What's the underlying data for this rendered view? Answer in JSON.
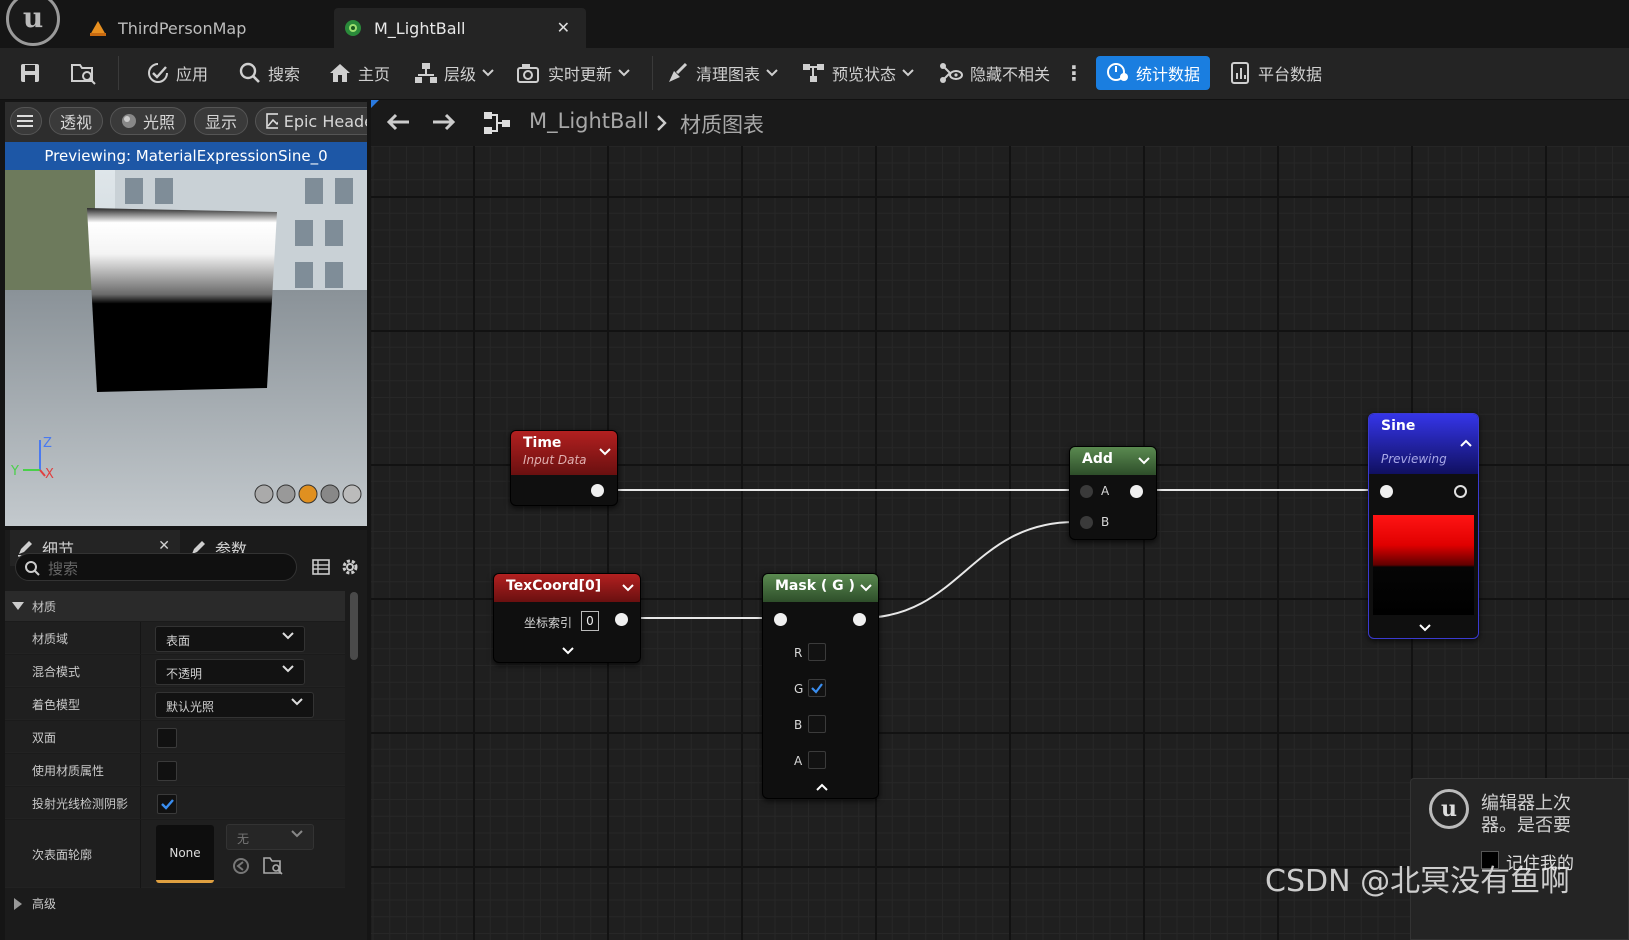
{
  "tabs": [
    {
      "label": "ThirdPersonMap"
    },
    {
      "label": "M_LightBall"
    }
  ],
  "toolbar": {
    "apply": "应用",
    "search": "搜索",
    "home": "主页",
    "hierarchy": "层级",
    "live_update": "实时更新",
    "clean_graph": "清理图表",
    "preview_state": "预览状态",
    "hide_unrelated": "隐藏不相关",
    "stats": "统计数据",
    "platform_stats": "平台数据"
  },
  "viewport": {
    "buttons": [
      "透视",
      "光照",
      "显示",
      "Epic Heade"
    ],
    "preview_label": "Previewing: MaterialExpressionSine_0",
    "axes": {
      "z": "Z",
      "y": "Y",
      "x": "X"
    }
  },
  "details": {
    "tabs": [
      "细节",
      "参数"
    ],
    "search_placeholder": "搜索",
    "section": "材质",
    "rows": [
      {
        "label": "材质域",
        "value": "表面"
      },
      {
        "label": "混合模式",
        "value": "不透明"
      },
      {
        "label": "着色模型",
        "value": "默认光照"
      },
      {
        "label": "双面"
      },
      {
        "label": "使用材质属性"
      },
      {
        "label": "投射光线检测阴影",
        "checked": true
      },
      {
        "label": "次表面轮廓",
        "value": "None",
        "dropdown": "无"
      }
    ],
    "advanced": "高级"
  },
  "graph": {
    "breadcrumb": {
      "asset": "M_LightBall",
      "section": "材质图表"
    },
    "nodes": {
      "time": {
        "title": "Time",
        "subtitle": "Input Data",
        "color": "#8e1515"
      },
      "texcoord": {
        "title": "TexCoord[0]",
        "param_label": "坐标索引",
        "param_value": "0",
        "color": "#8e1515"
      },
      "mask": {
        "title": "Mask ( G )",
        "channels": [
          "R",
          "G",
          "B",
          "A"
        ],
        "checked": "G",
        "color": "#3e6a38"
      },
      "add": {
        "title": "Add",
        "inputs": [
          "A",
          "B"
        ],
        "color": "#3e6a38"
      },
      "sine": {
        "title": "Sine",
        "subtitle": "Previewing",
        "color": "#2020c8"
      }
    }
  },
  "toast": {
    "line1": "编辑器上次",
    "line2": "器。是否要",
    "checkbox": "记住我的"
  },
  "watermark": "CSDN @北冥没有鱼啊"
}
